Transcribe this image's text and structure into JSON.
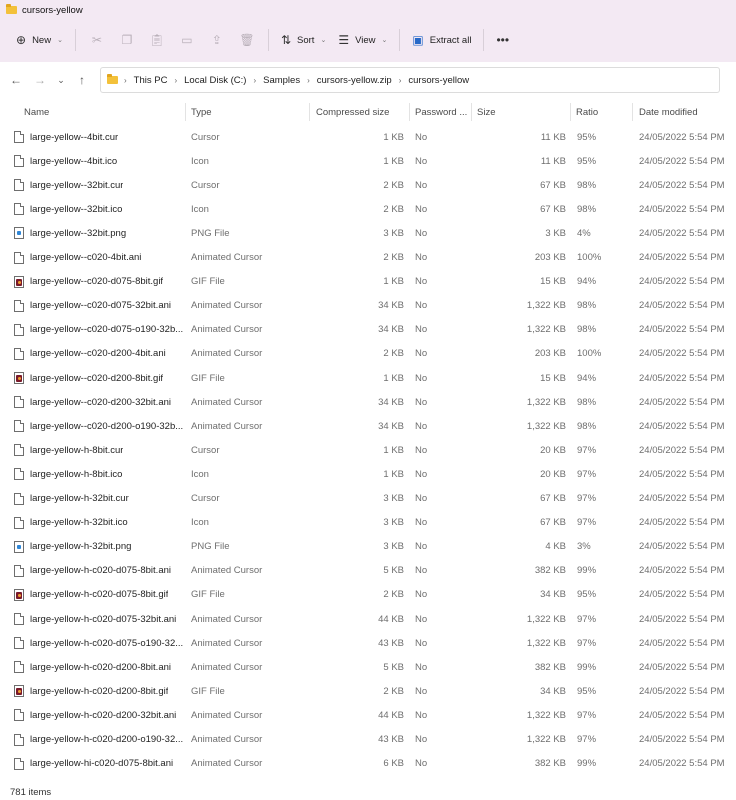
{
  "window": {
    "title": "cursors-yellow"
  },
  "toolbar": {
    "new_label": "New",
    "sort_label": "Sort",
    "view_label": "View",
    "extract_label": "Extract all",
    "more_label": "•••"
  },
  "address": {
    "crumbs": [
      "This PC",
      "Local Disk (C:)",
      "Samples",
      "cursors-yellow.zip",
      "cursors-yellow"
    ]
  },
  "columns": {
    "name": "Name",
    "type": "Type",
    "compressed": "Compressed size",
    "password": "Password ...",
    "size": "Size",
    "ratio": "Ratio",
    "date": "Date modified"
  },
  "files": [
    {
      "name": "large-yellow--4bit.cur",
      "icon": "doc",
      "type": "Cursor",
      "compressed": "1 KB",
      "password": "No",
      "size": "11 KB",
      "ratio": "95%",
      "date": "24/05/2022 5:54 PM"
    },
    {
      "name": "large-yellow--4bit.ico",
      "icon": "doc",
      "type": "Icon",
      "compressed": "1 KB",
      "password": "No",
      "size": "11 KB",
      "ratio": "95%",
      "date": "24/05/2022 5:54 PM"
    },
    {
      "name": "large-yellow--32bit.cur",
      "icon": "doc",
      "type": "Cursor",
      "compressed": "2 KB",
      "password": "No",
      "size": "67 KB",
      "ratio": "98%",
      "date": "24/05/2022 5:54 PM"
    },
    {
      "name": "large-yellow--32bit.ico",
      "icon": "doc",
      "type": "Icon",
      "compressed": "2 KB",
      "password": "No",
      "size": "67 KB",
      "ratio": "98%",
      "date": "24/05/2022 5:54 PM"
    },
    {
      "name": "large-yellow--32bit.png",
      "icon": "png",
      "type": "PNG File",
      "compressed": "3 KB",
      "password": "No",
      "size": "3 KB",
      "ratio": "4%",
      "date": "24/05/2022 5:54 PM"
    },
    {
      "name": "large-yellow--c020-4bit.ani",
      "icon": "doc",
      "type": "Animated Cursor",
      "compressed": "2 KB",
      "password": "No",
      "size": "203 KB",
      "ratio": "100%",
      "date": "24/05/2022 5:54 PM"
    },
    {
      "name": "large-yellow--c020-d075-8bit.gif",
      "icon": "gif",
      "type": "GIF File",
      "compressed": "1 KB",
      "password": "No",
      "size": "15 KB",
      "ratio": "94%",
      "date": "24/05/2022 5:54 PM"
    },
    {
      "name": "large-yellow--c020-d075-32bit.ani",
      "icon": "doc",
      "type": "Animated Cursor",
      "compressed": "34 KB",
      "password": "No",
      "size": "1,322 KB",
      "ratio": "98%",
      "date": "24/05/2022 5:54 PM"
    },
    {
      "name": "large-yellow--c020-d075-o190-32b...",
      "icon": "doc",
      "type": "Animated Cursor",
      "compressed": "34 KB",
      "password": "No",
      "size": "1,322 KB",
      "ratio": "98%",
      "date": "24/05/2022 5:54 PM"
    },
    {
      "name": "large-yellow--c020-d200-4bit.ani",
      "icon": "doc",
      "type": "Animated Cursor",
      "compressed": "2 KB",
      "password": "No",
      "size": "203 KB",
      "ratio": "100%",
      "date": "24/05/2022 5:54 PM"
    },
    {
      "name": "large-yellow--c020-d200-8bit.gif",
      "icon": "gif",
      "type": "GIF File",
      "compressed": "1 KB",
      "password": "No",
      "size": "15 KB",
      "ratio": "94%",
      "date": "24/05/2022 5:54 PM"
    },
    {
      "name": "large-yellow--c020-d200-32bit.ani",
      "icon": "doc",
      "type": "Animated Cursor",
      "compressed": "34 KB",
      "password": "No",
      "size": "1,322 KB",
      "ratio": "98%",
      "date": "24/05/2022 5:54 PM"
    },
    {
      "name": "large-yellow--c020-d200-o190-32b...",
      "icon": "doc",
      "type": "Animated Cursor",
      "compressed": "34 KB",
      "password": "No",
      "size": "1,322 KB",
      "ratio": "98%",
      "date": "24/05/2022 5:54 PM"
    },
    {
      "name": "large-yellow-h-8bit.cur",
      "icon": "doc",
      "type": "Cursor",
      "compressed": "1 KB",
      "password": "No",
      "size": "20 KB",
      "ratio": "97%",
      "date": "24/05/2022 5:54 PM"
    },
    {
      "name": "large-yellow-h-8bit.ico",
      "icon": "doc",
      "type": "Icon",
      "compressed": "1 KB",
      "password": "No",
      "size": "20 KB",
      "ratio": "97%",
      "date": "24/05/2022 5:54 PM"
    },
    {
      "name": "large-yellow-h-32bit.cur",
      "icon": "doc",
      "type": "Cursor",
      "compressed": "3 KB",
      "password": "No",
      "size": "67 KB",
      "ratio": "97%",
      "date": "24/05/2022 5:54 PM"
    },
    {
      "name": "large-yellow-h-32bit.ico",
      "icon": "doc",
      "type": "Icon",
      "compressed": "3 KB",
      "password": "No",
      "size": "67 KB",
      "ratio": "97%",
      "date": "24/05/2022 5:54 PM"
    },
    {
      "name": "large-yellow-h-32bit.png",
      "icon": "png",
      "type": "PNG File",
      "compressed": "3 KB",
      "password": "No",
      "size": "4 KB",
      "ratio": "3%",
      "date": "24/05/2022 5:54 PM"
    },
    {
      "name": "large-yellow-h-c020-d075-8bit.ani",
      "icon": "doc",
      "type": "Animated Cursor",
      "compressed": "5 KB",
      "password": "No",
      "size": "382 KB",
      "ratio": "99%",
      "date": "24/05/2022 5:54 PM"
    },
    {
      "name": "large-yellow-h-c020-d075-8bit.gif",
      "icon": "gif",
      "type": "GIF File",
      "compressed": "2 KB",
      "password": "No",
      "size": "34 KB",
      "ratio": "95%",
      "date": "24/05/2022 5:54 PM"
    },
    {
      "name": "large-yellow-h-c020-d075-32bit.ani",
      "icon": "doc",
      "type": "Animated Cursor",
      "compressed": "44 KB",
      "password": "No",
      "size": "1,322 KB",
      "ratio": "97%",
      "date": "24/05/2022 5:54 PM"
    },
    {
      "name": "large-yellow-h-c020-d075-o190-32...",
      "icon": "doc",
      "type": "Animated Cursor",
      "compressed": "43 KB",
      "password": "No",
      "size": "1,322 KB",
      "ratio": "97%",
      "date": "24/05/2022 5:54 PM"
    },
    {
      "name": "large-yellow-h-c020-d200-8bit.ani",
      "icon": "doc",
      "type": "Animated Cursor",
      "compressed": "5 KB",
      "password": "No",
      "size": "382 KB",
      "ratio": "99%",
      "date": "24/05/2022 5:54 PM"
    },
    {
      "name": "large-yellow-h-c020-d200-8bit.gif",
      "icon": "gif",
      "type": "GIF File",
      "compressed": "2 KB",
      "password": "No",
      "size": "34 KB",
      "ratio": "95%",
      "date": "24/05/2022 5:54 PM"
    },
    {
      "name": "large-yellow-h-c020-d200-32bit.ani",
      "icon": "doc",
      "type": "Animated Cursor",
      "compressed": "44 KB",
      "password": "No",
      "size": "1,322 KB",
      "ratio": "97%",
      "date": "24/05/2022 5:54 PM"
    },
    {
      "name": "large-yellow-h-c020-d200-o190-32...",
      "icon": "doc",
      "type": "Animated Cursor",
      "compressed": "43 KB",
      "password": "No",
      "size": "1,322 KB",
      "ratio": "97%",
      "date": "24/05/2022 5:54 PM"
    },
    {
      "name": "large-yellow-hi-c020-d075-8bit.ani",
      "icon": "doc",
      "type": "Animated Cursor",
      "compressed": "6 KB",
      "password": "No",
      "size": "382 KB",
      "ratio": "99%",
      "date": "24/05/2022 5:54 PM"
    }
  ],
  "status": {
    "item_count": "781 items"
  },
  "colors": {
    "chrome_bg": "#f3e9f3",
    "folder": "#f3c13a",
    "accent": "#2769c8"
  }
}
